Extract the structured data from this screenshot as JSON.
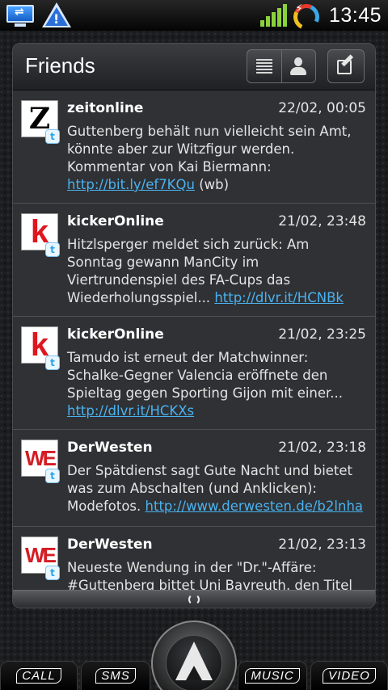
{
  "status_bar": {
    "time": "13:45",
    "left_icons": [
      "usb-debug-icon",
      "warning-icon"
    ],
    "right_icons": [
      "signal-icon",
      "battery-icon"
    ]
  },
  "widget": {
    "title": "Friends",
    "buttons": [
      "list-view-icon",
      "person-icon",
      "compose-icon"
    ],
    "feed": [
      {
        "author": "zeitonline",
        "time": "22/02, 00:05",
        "avatar": "Z",
        "text": "Guttenberg behält nun vielleicht sein Amt, könnte aber zur Witzfigur werden. Kommentar von Kai Biermann: ",
        "link": "http://bit.ly/ef7KQu",
        "suffix": " (wb)"
      },
      {
        "author": "kickerOnline",
        "time": "21/02, 23:48",
        "avatar": "k",
        "text": "Hitzlsperger meldet sich zurück: Am Sonntag gewann ManCity im Viertrundenspiel des FA-Cups das Wiederholungsspiel... ",
        "link": "http://dlvr.it/HCNBk",
        "suffix": ""
      },
      {
        "author": "kickerOnline",
        "time": "21/02, 23:25",
        "avatar": "k",
        "text": "Tamudo ist erneut der Matchwinner: Schalke-Gegner Valencia eröffnete den Spieltag gegen Sporting Gijon mit einer... ",
        "link": "http://dlvr.it/HCKXs",
        "suffix": ""
      },
      {
        "author": "DerWesten",
        "time": "21/02, 23:18",
        "avatar": "WE",
        "text": "Der Spätdienst sagt Gute Nacht und bietet was zum Abschalten (und Anklicken): Modefotos. ",
        "link": "http://www.derwesten.de/b2lnha",
        "suffix": ""
      },
      {
        "author": "DerWesten",
        "time": "21/02, 23:13",
        "avatar": "WE",
        "text": "Neueste Wendung in der \"Dr.\"-Affäre: #Guttenberg bittet Uni Bayreuth, den Titel",
        "link": "",
        "suffix": ""
      }
    ]
  },
  "dock": {
    "call": "CALL",
    "sms": "SMS",
    "music": "MUSIC",
    "video": "VIDEO"
  },
  "colors": {
    "link": "#4ab2f0",
    "kicker_red": "#e0161e",
    "derwesten_red": "#d41d24",
    "signal_green": "#8bd23a"
  }
}
